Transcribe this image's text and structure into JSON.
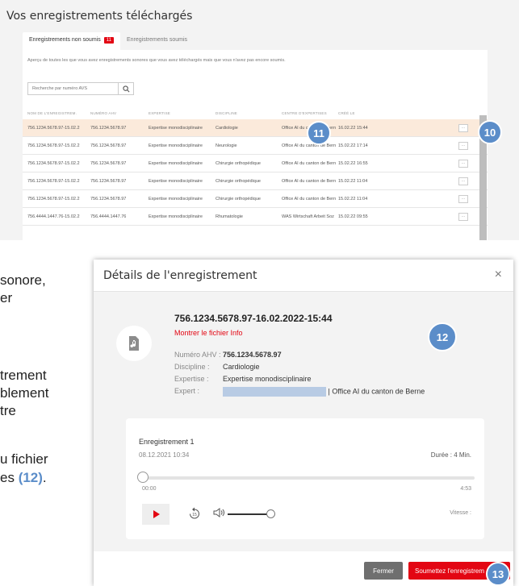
{
  "panel": {
    "title": "Vos enregistrements téléchargés",
    "tabs": [
      {
        "label": "Enregistrements non soumis",
        "badge": "11"
      },
      {
        "label": "Enregistrements soumis"
      }
    ],
    "description": "Aperçu de toutes les que vous avez enregistrements sonores que vous avez téléchargés mais que vous n'avez pas encore soumis.",
    "search_placeholder": "Recherche par numéro AVS",
    "columns": [
      "Nom de l'enregistrem.",
      "Numéro AHV",
      "Expertise",
      "Discipline",
      "Centre d'expertises",
      "Créé le"
    ],
    "rows": [
      {
        "name": "756.1234.5678.97-15.02.2",
        "ahv": "756.1234.5678.97",
        "expertise": "Expertise monodisciplinaire",
        "discipline": "Cardiologie",
        "centre": "Office AI du canton de Bern",
        "date": "16.02.22 15:44",
        "selected": true
      },
      {
        "name": "756.1234.5678.97-15.02.2",
        "ahv": "756.1234.5678.97",
        "expertise": "Expertise monodisciplinaire",
        "discipline": "Neurologie",
        "centre": "Office AI du canton de Bern",
        "date": "15.02.22 17:14",
        "selected": false
      },
      {
        "name": "756.1234.5678.97-15.02.2",
        "ahv": "756.1234.5678.97",
        "expertise": "Expertise monodisciplinaire",
        "discipline": "Chirurgie orthopédique",
        "centre": "Office AI du canton de Bern",
        "date": "15.02.22 16:55",
        "selected": false
      },
      {
        "name": "756.1234.5678.97-15.02.2",
        "ahv": "756.1234.5678.97",
        "expertise": "Expertise monodisciplinaire",
        "discipline": "Chirurgie orthopédique",
        "centre": "Office AI du canton de Bern",
        "date": "15.02.22 11:04",
        "selected": false
      },
      {
        "name": "756.1234.5678.97-15.02.2",
        "ahv": "756.1234.5678.97",
        "expertise": "Expertise monodisciplinaire",
        "discipline": "Chirurgie orthopédique",
        "centre": "Office AI du canton de Bern",
        "date": "15.02.22 11:04",
        "selected": false
      },
      {
        "name": "756.4444.1447.76-15.02.2",
        "ahv": "756.4444.1447.76",
        "expertise": "Expertise monodisciplinaire",
        "discipline": "Rhumatologie",
        "centre": "WAS Wirtschaft Arbeit Soz",
        "date": "15.02.22 09:55",
        "selected": false
      }
    ],
    "more_label": "..."
  },
  "callouts": {
    "c10": "10",
    "c11": "11",
    "c12": "12",
    "c13": "13"
  },
  "side_text": {
    "line1": "sonore,",
    "line2": "er",
    "line3": "trement",
    "line4": "blement",
    "line5": "tre",
    "line6": "u fichier",
    "line7_prefix": "es ",
    "line7_ref": "(12)",
    "line7_suffix": "."
  },
  "modal": {
    "title": "Détails de l'enregistrement",
    "close_glyph": "×",
    "recording_name": "756.1234.5678.97-16.02.2022-15:44",
    "info_link": "Montrer le fichier Info",
    "fields": [
      {
        "label": "Numéro AHV :",
        "value": "756.1234.5678.97",
        "bold": true
      },
      {
        "label": "Discipline :",
        "value": "Cardiologie"
      },
      {
        "label": "Expertise :",
        "value": "Expertise monodisciplinaire"
      },
      {
        "label": "Expert :",
        "value": "| Office AI du canton de Berne"
      }
    ],
    "player": {
      "title": "Enregistrement 1",
      "date": "08.12.2021 10:34",
      "duration": "Durée : 4 Min.",
      "time_current": "00:00",
      "time_total": "4:53",
      "progress": 0,
      "volume": 1,
      "speed_label": "Vitesse :"
    },
    "close_button": "Fermer",
    "submit_button": "Soumettez l'enregistrem"
  },
  "colors": {
    "accent_red": "#e30613",
    "callout_blue": "#5b8dc9",
    "selected_row": "#fbeadb"
  },
  "icons": [
    "search-icon",
    "audio-file-icon",
    "play-icon",
    "rewind-15-icon",
    "volume-icon",
    "close-icon"
  ]
}
